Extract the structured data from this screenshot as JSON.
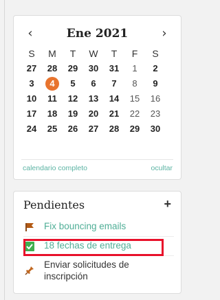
{
  "calendar": {
    "month": "Ene",
    "year": "2021",
    "prev_icon": "chevron-left-icon",
    "next_icon": "chevron-right-icon",
    "weekdays": [
      "S",
      "M",
      "T",
      "W",
      "T",
      "F",
      "S"
    ],
    "weeks": [
      [
        "27",
        "28",
        "29",
        "30",
        "31",
        "1",
        "2"
      ],
      [
        "3",
        "4",
        "5",
        "6",
        "7",
        "8",
        "9"
      ],
      [
        "10",
        "11",
        "12",
        "13",
        "14",
        "15",
        "16"
      ],
      [
        "17",
        "18",
        "19",
        "20",
        "21",
        "22",
        "23"
      ],
      [
        "24",
        "25",
        "26",
        "27",
        "28",
        "29",
        "30"
      ]
    ],
    "today": "4",
    "full_calendar_link": "calendario completo",
    "hide_link": "ocultar",
    "accent_color": "#e8742e"
  },
  "todo": {
    "title": "Pendientes",
    "add_label": "+",
    "items": [
      {
        "label": "Fix bouncing emails",
        "icon": "flag-icon"
      },
      {
        "label": "18 fechas de entrega",
        "icon": "checkbox-checked-icon"
      },
      {
        "label_line1": "Enviar solicitudes de",
        "label_line2": "inscripción",
        "icon": "pin-icon"
      }
    ],
    "link_color": "#4fae96",
    "highlight_color": "#e8102a"
  }
}
